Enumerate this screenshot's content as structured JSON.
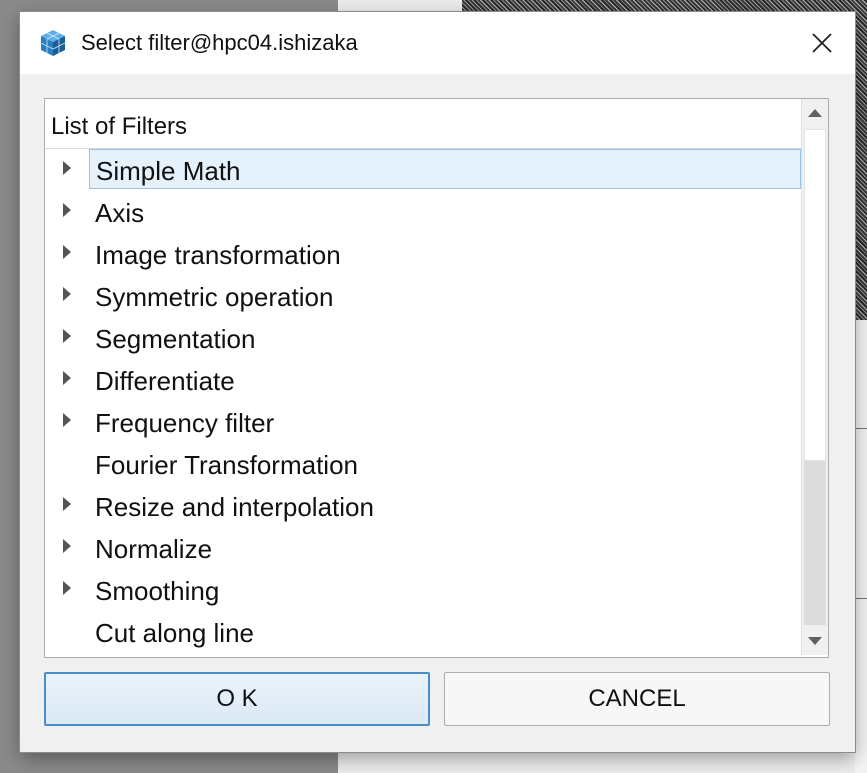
{
  "dialog": {
    "title": "Select filter@hpc04.ishizaka",
    "icon": "cube-app-icon",
    "close_icon": "close-icon"
  },
  "tree": {
    "header": "List of Filters",
    "items": [
      {
        "label": "Simple Math",
        "expandable": true,
        "selected": true
      },
      {
        "label": "Axis",
        "expandable": true
      },
      {
        "label": "Image transformation",
        "expandable": true
      },
      {
        "label": "Symmetric operation",
        "expandable": true
      },
      {
        "label": "Segmentation",
        "expandable": true
      },
      {
        "label": "Differentiate",
        "expandable": true
      },
      {
        "label": "Frequency filter",
        "expandable": true
      },
      {
        "label": "Fourier Transformation",
        "expandable": false
      },
      {
        "label": "Resize and interpolation",
        "expandable": true
      },
      {
        "label": "Normalize",
        "expandable": true
      },
      {
        "label": "Smoothing",
        "expandable": true
      },
      {
        "label": "Cut along line",
        "expandable": false
      }
    ]
  },
  "buttons": {
    "ok": "O K",
    "cancel": "CANCEL"
  },
  "colors": {
    "selection_bg": "#e5f1fb",
    "selection_border": "#99c4e8",
    "ok_border": "#4a8ec9"
  }
}
